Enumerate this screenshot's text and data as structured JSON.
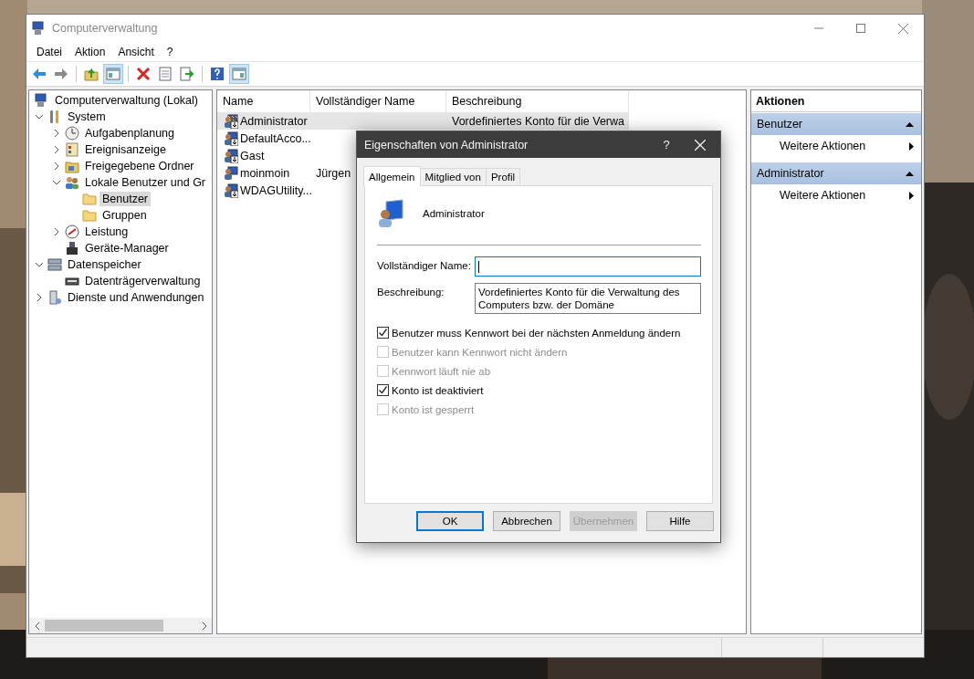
{
  "window": {
    "title": "Computerverwaltung"
  },
  "menu": [
    "Datei",
    "Aktion",
    "Ansicht",
    "?"
  ],
  "toolbar": [
    {
      "kind": "back",
      "pressed": false
    },
    {
      "kind": "forward",
      "pressed": false
    },
    {
      "kind": "separator"
    },
    {
      "kind": "folder-up",
      "pressed": false
    },
    {
      "kind": "tree-toggle",
      "pressed": true
    },
    {
      "kind": "separator"
    },
    {
      "kind": "delete",
      "pressed": false
    },
    {
      "kind": "properties",
      "pressed": false
    },
    {
      "kind": "export",
      "pressed": false
    },
    {
      "kind": "separator"
    },
    {
      "kind": "help",
      "pressed": false
    },
    {
      "kind": "pane-toggle",
      "pressed": true
    }
  ],
  "tree": [
    {
      "label": "Computerverwaltung (Lokal)",
      "kind": "computer",
      "selected": false,
      "children": [
        {
          "label": "System",
          "kind": "tools",
          "expanded": true,
          "selected": false,
          "children": [
            {
              "label": "Aufgabenplanung",
              "kind": "clock",
              "expanded": false,
              "selected": false
            },
            {
              "label": "Ereignisanzeige",
              "kind": "log",
              "expanded": false,
              "selected": false
            },
            {
              "label": "Freigegebene Ordner",
              "kind": "share",
              "expanded": false,
              "selected": false
            },
            {
              "label": "Lokale Benutzer und Gr",
              "kind": "users",
              "expanded": true,
              "selected": false,
              "children": [
                {
                  "label": "Benutzer",
                  "kind": "folder",
                  "selected": true
                },
                {
                  "label": "Gruppen",
                  "kind": "folder",
                  "selected": false
                }
              ]
            },
            {
              "label": "Leistung",
              "kind": "gauge",
              "expanded": false,
              "selected": false
            },
            {
              "label": "Geräte-Manager",
              "kind": "device",
              "selected": false
            }
          ]
        },
        {
          "label": "Datenspeicher",
          "kind": "storage",
          "expanded": true,
          "selected": false,
          "children": [
            {
              "label": "Datenträgerverwaltung",
              "kind": "disk",
              "selected": false
            }
          ]
        },
        {
          "label": "Dienste und Anwendungen",
          "kind": "services",
          "expanded": false,
          "selected": false
        }
      ]
    }
  ],
  "list": {
    "columns": [
      "Name",
      "Vollständiger Name",
      "Beschreibung"
    ],
    "rows": [
      {
        "name": "Administrator",
        "description": "Vordefiniertes Konto für die Verwa",
        "selected": true,
        "disabled": true
      },
      {
        "name": "DefaultAcco...",
        "selected": false,
        "disabled": true
      },
      {
        "name": "Gast",
        "selected": false,
        "disabled": true
      },
      {
        "name": "moinmoin",
        "full_name": "Jürgen",
        "selected": false,
        "disabled": false
      },
      {
        "name": "WDAGUtility...",
        "selected": false,
        "disabled": true
      }
    ]
  },
  "actions": {
    "title": "Aktionen",
    "sections": [
      {
        "title": "Benutzer",
        "expanded": true,
        "items": [
          "Weitere Aktionen"
        ]
      },
      {
        "title": "Administrator",
        "expanded": true,
        "items": [
          "Weitere Aktionen"
        ]
      }
    ]
  },
  "dialog": {
    "title": "Eigenschaften von Administrator",
    "help": "?",
    "tabs": [
      {
        "label": "Allgemein",
        "selected": true
      },
      {
        "label": "Mitglied von",
        "selected": false
      },
      {
        "label": "Profil",
        "selected": false
      }
    ],
    "account": "Administrator",
    "fields": [
      {
        "label": "Vollständiger Name:",
        "focused": true
      },
      {
        "label": "Beschreibung:",
        "value": "Vordefiniertes Konto für die Verwaltung des Computers bzw. der Domäne",
        "focused": false
      }
    ],
    "options": [
      {
        "label": "Benutzer muss Kennwort bei der nächsten Anmeldung ändern",
        "checked": true,
        "disabled": false
      },
      {
        "label": "Benutzer kann Kennwort nicht ändern",
        "checked": false,
        "disabled": true
      },
      {
        "label": "Kennwort läuft nie ab",
        "checked": false,
        "disabled": true
      },
      {
        "label": "Konto ist deaktiviert",
        "checked": true,
        "disabled": false
      },
      {
        "label": "Konto ist gesperrt",
        "checked": false,
        "disabled": true
      }
    ],
    "buttons": [
      {
        "label": "OK",
        "default": true,
        "disabled": false
      },
      {
        "label": "Abbrechen",
        "default": false,
        "disabled": false
      },
      {
        "label": "Übernehmen",
        "default": false,
        "disabled": true
      },
      {
        "label": "Hilfe",
        "default": false,
        "disabled": false
      }
    ]
  }
}
